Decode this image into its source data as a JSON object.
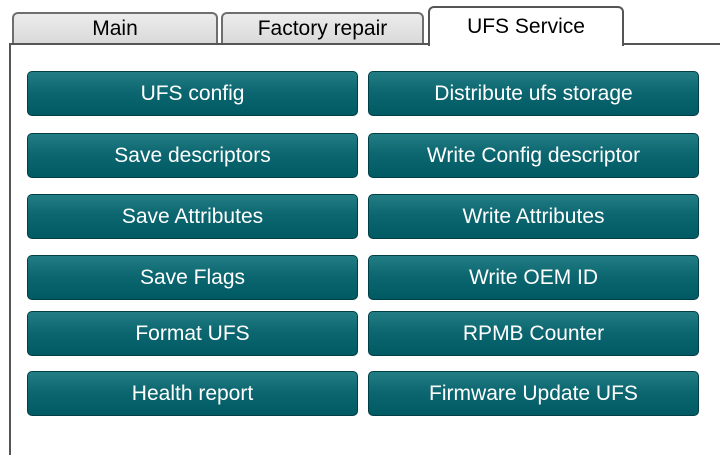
{
  "tabs": {
    "main": "Main",
    "factory_repair": "Factory repair",
    "ufs_service": "UFS Service",
    "active": "UFS Service"
  },
  "buttons": {
    "left": [
      "UFS config",
      "Save descriptors",
      "Save Attributes",
      "Save Flags",
      "Format UFS",
      "Health report"
    ],
    "right": [
      "Distribute ufs storage",
      "Write Config descriptor",
      "Write Attributes",
      "Write OEM ID",
      "RPMB Counter",
      "Firmware Update UFS"
    ]
  },
  "colors": {
    "button_bg": "#0d6770",
    "button_text": "#ffffff",
    "tab_inactive_bg": "#d9d9d9"
  }
}
